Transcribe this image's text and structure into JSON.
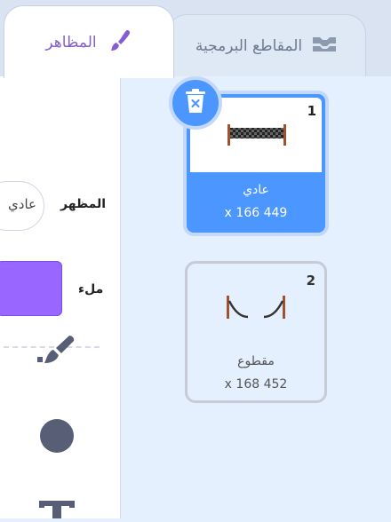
{
  "tabs": {
    "costumes_label": "المظاهر",
    "code_label": "المقاطع البرمجية",
    "costumes_icon": "paintbrush-icon",
    "code_icon": "code-blocks-icon"
  },
  "editor": {
    "costume_label": "المظهر",
    "costume_name_value": "عادي",
    "fill_label": "ملء",
    "fill_color": "#9966ff",
    "tools": [
      "brush-icon",
      "circle-icon",
      "text-icon"
    ]
  },
  "costumes": [
    {
      "number": "1",
      "name": "عادي",
      "size": "x 166 449",
      "selected": true
    },
    {
      "number": "2",
      "name": "مقطوع",
      "size": "x 168 452",
      "selected": false
    }
  ],
  "colors": {
    "accent": "#4c97ff",
    "purple": "#855cd6"
  }
}
